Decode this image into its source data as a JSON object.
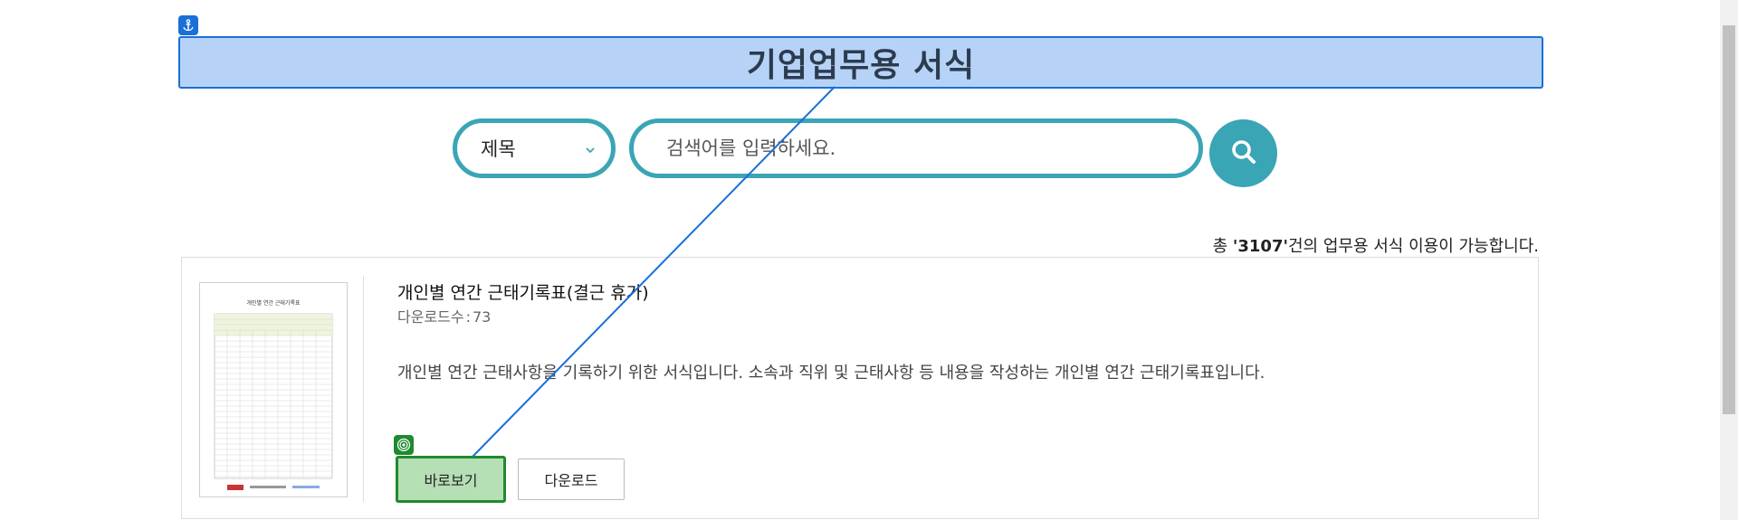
{
  "header": {
    "title": "기업업무용 서식",
    "anchor_icon": "anchor-icon",
    "accent_color": "#1a6fd8"
  },
  "search": {
    "select_value": "제목",
    "placeholder": "검색어를 입력하세요.",
    "button_icon": "search-icon",
    "accent_color": "#3aa5b5"
  },
  "summary": {
    "prefix": "총 ",
    "count": "'3107'",
    "suffix": "건의 업무용 서식 이용이 가능합니다."
  },
  "item": {
    "title": "개인별 연간 근태기록표(결근 휴가)",
    "downloads_label": "다운로드수",
    "downloads_colon": ":",
    "downloads_count": "73",
    "description": "개인별 연간 근태사항을 기록하기 위한 서식입니다. 소속과 직위 및 근태사항 등 내용을 작성하는 개인별 연간 근태기록표입니다.",
    "thumbnail_title": "개인별 연간 근태기록표",
    "preview_label": "바로보기",
    "download_label": "다운로드",
    "target_icon": "target-icon",
    "highlight_color": "#1f8a2e"
  }
}
